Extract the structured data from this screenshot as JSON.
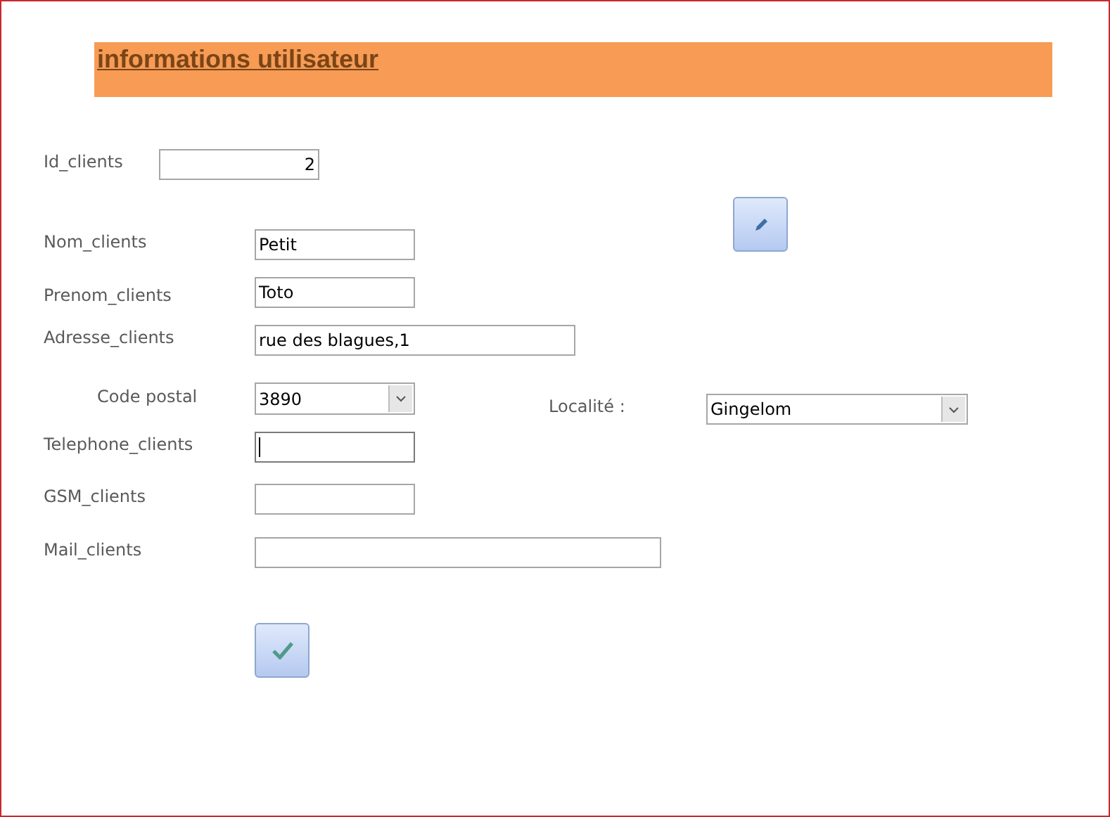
{
  "header": {
    "title": "informations utilisateur"
  },
  "fields": [
    {
      "label": "Id_clients",
      "kind": "number",
      "value": "2",
      "focused": false
    },
    {
      "label": "Nom_clients",
      "kind": "text",
      "value": "Petit",
      "focused": false
    },
    {
      "label": "Prenom_clients",
      "kind": "text",
      "value": "Toto",
      "focused": false
    },
    {
      "label": "Adresse_clients",
      "kind": "text",
      "value": "rue des blagues,1",
      "focused": false
    },
    {
      "label": "Code postal",
      "kind": "combo",
      "value": "3890",
      "focused": false
    },
    {
      "label": "Localité :",
      "kind": "combo",
      "value": "Gingelom",
      "focused": false
    },
    {
      "label": "Telephone_clients",
      "kind": "text",
      "focused": true
    },
    {
      "label": "GSM_clients",
      "kind": "text",
      "focused": false
    },
    {
      "label": "Mail_clients",
      "kind": "text",
      "focused": false
    }
  ],
  "buttons": [
    {
      "kind": "edit"
    },
    {
      "kind": "confirm"
    }
  ]
}
